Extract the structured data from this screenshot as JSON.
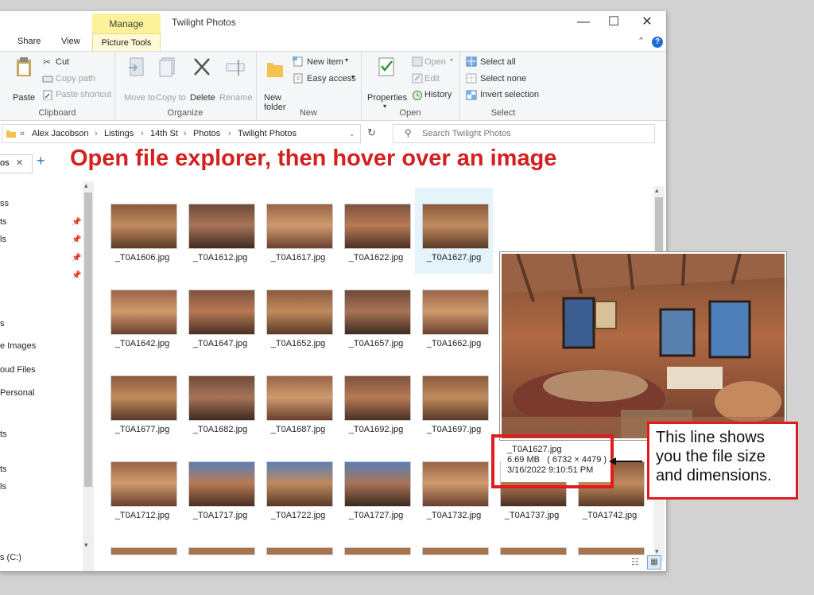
{
  "window": {
    "title": "Twilight Photos",
    "contextual_tab": "Manage",
    "controls": {
      "minimize": "—",
      "maximize": "☐",
      "close": "✕"
    }
  },
  "ribbon_tabs": {
    "share": "Share",
    "view": "View",
    "picture_tools": "Picture Tools",
    "help": "?"
  },
  "ribbon": {
    "clipboard": {
      "label": "Clipboard",
      "cut": "Cut",
      "copy_path": "Copy path",
      "paste": "Paste",
      "paste_shortcut": "Paste shortcut"
    },
    "organize": {
      "label": "Organize",
      "move_to": "Move to",
      "copy_to": "Copy to",
      "delete": "Delete",
      "rename": "Rename"
    },
    "new": {
      "label": "New",
      "new_folder": "New folder",
      "new_item": "New item",
      "easy_access": "Easy access"
    },
    "open": {
      "label": "Open",
      "properties": "Properties",
      "open": "Open",
      "edit": "Edit",
      "history": "History"
    },
    "select": {
      "label": "Select",
      "select_all": "Select all",
      "select_none": "Select none",
      "invert_selection": "Invert selection"
    }
  },
  "address": {
    "prefix": "«",
    "crumbs": [
      "Alex Jacobson",
      "Listings",
      "14th St",
      "Photos",
      "Twilight Photos"
    ],
    "search_placeholder": "Search Twilight Photos"
  },
  "nav": {
    "tab_label": "os",
    "add": "+",
    "close": "✕",
    "items": [
      "ss",
      "ts",
      "ls",
      "",
      "",
      "s",
      "e Images",
      "oud Files",
      "Personal",
      "ts",
      "ts",
      "ls",
      "s (C:)"
    ]
  },
  "headline": "Open file explorer, then hover over an image",
  "files": [
    "_T0A1606.jpg",
    "_T0A1612.jpg",
    "_T0A1617.jpg",
    "_T0A1622.jpg",
    "_T0A1627.jpg",
    "",
    "",
    "_T0A1642.jpg",
    "_T0A1647.jpg",
    "_T0A1652.jpg",
    "_T0A1657.jpg",
    "_T0A1662.jpg",
    "",
    "",
    "_T0A1677.jpg",
    "_T0A1682.jpg",
    "_T0A1687.jpg",
    "_T0A1692.jpg",
    "_T0A1697.jpg",
    "",
    "",
    "_T0A1712.jpg",
    "_T0A1717.jpg",
    "_T0A1722.jpg",
    "_T0A1727.jpg",
    "_T0A1732.jpg",
    "_T0A1737.jpg",
    "_T0A1742.jpg"
  ],
  "hover_tooltip": {
    "name": "_T0A1627.jpg",
    "size": "6.69 MB",
    "dimensions": "( 6732 × 4479 )",
    "date": "3/16/2022 9:10:51 PM"
  },
  "callout": "This line shows you the file size and dimensions.",
  "colors": {
    "accent_red": "#e01c1c",
    "headline_red": "#d42020",
    "manage_yellow": "#fbf29a",
    "selection": "#e5f3fb"
  }
}
